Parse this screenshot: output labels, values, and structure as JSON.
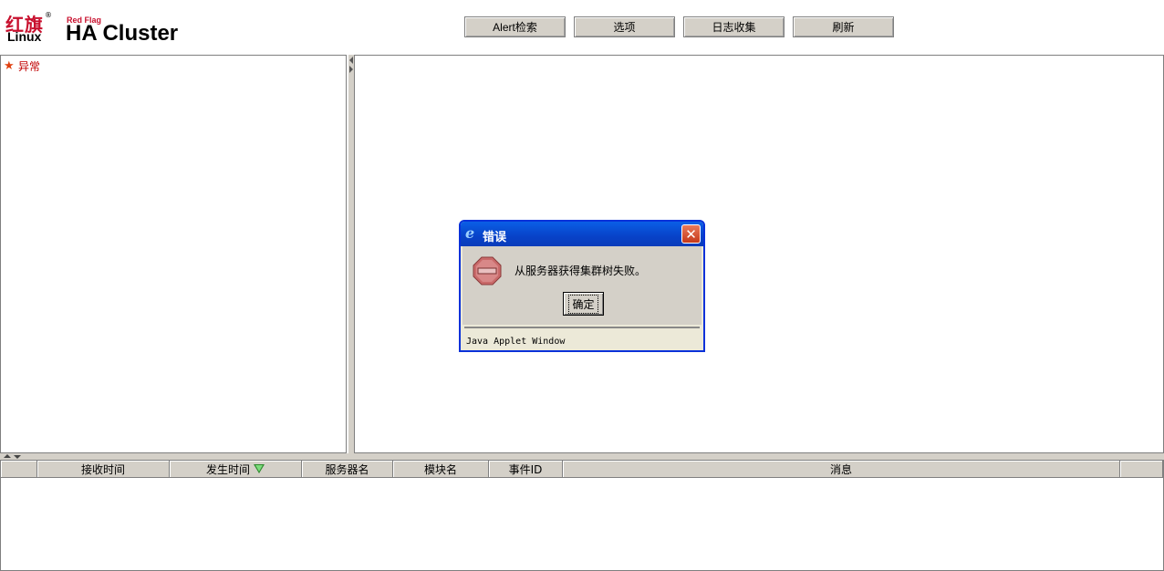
{
  "logo": {
    "cn_text": "红旗",
    "reg_mark": "®",
    "linux_text": "Linux",
    "redflag_text": "Red Flag",
    "product_text": "HA Cluster"
  },
  "toolbar": {
    "alert_search_label": "Alert检索",
    "options_label": "选项",
    "log_collect_label": "日志收集",
    "refresh_label": "刷新"
  },
  "tree": {
    "items": [
      {
        "label": "异常",
        "icon": "warning-star-icon",
        "color": "#c00000"
      }
    ]
  },
  "table": {
    "columns": [
      "",
      "接收时间",
      "发生时间",
      "服务器名",
      "模块名",
      "事件ID",
      "消息",
      ""
    ],
    "sorted_column": "发生时间",
    "rows": []
  },
  "dialog": {
    "title": "错误",
    "message": "从服务器获得集群树失败。",
    "ok_label": "确定",
    "status_text": "Java Applet Window",
    "close_glyph": "✕",
    "icon": "stop-icon"
  },
  "colors": {
    "title_bar": "#0842c8",
    "chrome": "#d4d0c8",
    "alert_text": "#c00000"
  }
}
